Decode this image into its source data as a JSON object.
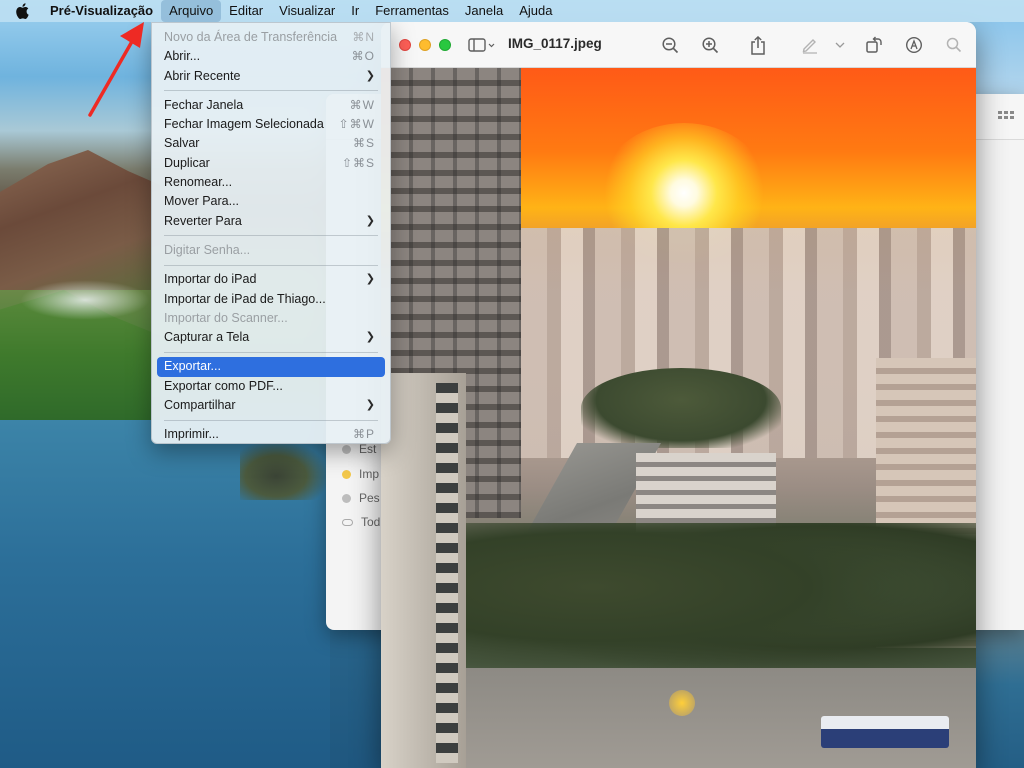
{
  "menubar": {
    "app_name": "Pré-Visualização",
    "items": [
      "Arquivo",
      "Editar",
      "Visualizar",
      "Ir",
      "Ferramentas",
      "Janela",
      "Ajuda"
    ]
  },
  "window": {
    "title": "IMG_0117.jpeg"
  },
  "background_window": {
    "sidebar_items": [
      "Est",
      "Imp",
      "Pes",
      "Tod"
    ]
  },
  "file_menu": {
    "items": [
      {
        "label": "Novo da Área de Transferência",
        "shortcut": "⌘N"
      },
      {
        "label": "Abrir...",
        "shortcut": "⌘O"
      },
      {
        "label": "Abrir Recente",
        "shortcut": ""
      },
      {
        "label": "Fechar Janela",
        "shortcut": "⌘W"
      },
      {
        "label": "Fechar Imagem Selecionada",
        "shortcut": "⇧⌘W"
      },
      {
        "label": "Salvar",
        "shortcut": "⌘S"
      },
      {
        "label": "Duplicar",
        "shortcut": "⇧⌘S"
      },
      {
        "label": "Renomear...",
        "shortcut": ""
      },
      {
        "label": "Mover Para...",
        "shortcut": ""
      },
      {
        "label": "Reverter Para",
        "shortcut": ""
      },
      {
        "label": "Digitar Senha...",
        "shortcut": ""
      },
      {
        "label": "Importar do iPad",
        "shortcut": ""
      },
      {
        "label": "Importar de iPad de Thiago...",
        "shortcut": ""
      },
      {
        "label": "Importar do Scanner...",
        "shortcut": ""
      },
      {
        "label": "Capturar a Tela",
        "shortcut": ""
      },
      {
        "label": "Exportar...",
        "shortcut": ""
      },
      {
        "label": "Exportar como PDF...",
        "shortcut": ""
      },
      {
        "label": "Compartilhar",
        "shortcut": ""
      },
      {
        "label": "Imprimir...",
        "shortcut": "⌘P"
      }
    ]
  },
  "colors": {
    "highlight": "#2e6fdf",
    "arrow": "#ee2a24"
  }
}
